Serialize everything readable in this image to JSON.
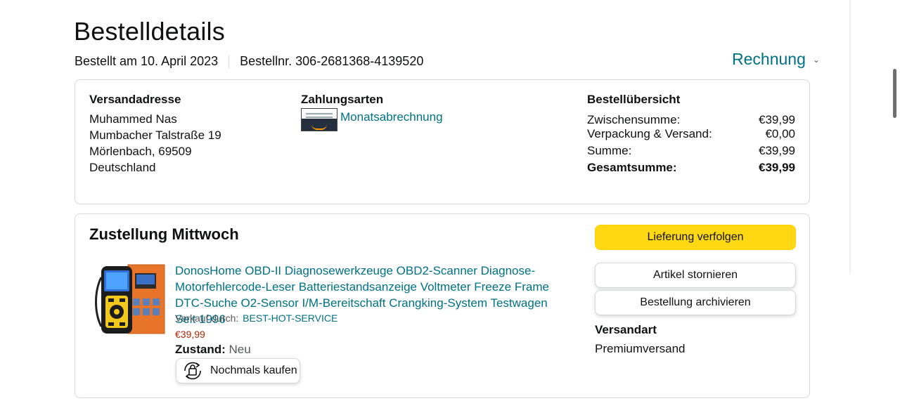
{
  "page": {
    "title": "Bestelldetails"
  },
  "order_meta": {
    "ordered_on": "Bestellt am 10. April 2023",
    "order_number": "Bestellnr. 306-2681368-4139520",
    "invoice_label": "Rechnung"
  },
  "address": {
    "heading": "Versandadresse",
    "name": "Muhammed Nas",
    "street": "Mumbacher Talstraße 19",
    "city": "Mörlenbach, 69509",
    "country": "Deutschland"
  },
  "payment": {
    "heading": "Zahlungsarten",
    "method": "Monatsabrechnung"
  },
  "summary": {
    "heading": "Bestellübersicht",
    "rows": [
      {
        "label": "Zwischensumme:",
        "value": "€39,99"
      },
      {
        "label": "Verpackung & Versand:",
        "value": "€0,00"
      },
      {
        "label": "Summe:",
        "value": "€39,99"
      },
      {
        "label": "Gesamtsumme:",
        "value": "€39,99"
      }
    ]
  },
  "delivery": {
    "title": "Zustellung Mittwoch",
    "product_title": "DonosHome OBD-II Diagnosewerkzeuge OBD2-Scanner Diagnose-Motorfehlercode-Leser Batteriestandsanzeige Voltmeter Freeze Frame DTC-Suche O2-Sensor I/M-Bereitschaft Crangking-System Testwagen Seit 1996",
    "sold_by_label": "Verkauf durch:",
    "seller": "BEST-HOT-SERVICE",
    "price": "€39,99",
    "condition_label": "Zustand:",
    "condition_value": "Neu",
    "rebuy_label": "Nochmals kaufen",
    "buttons": {
      "track": "Lieferung verfolgen",
      "cancel": "Artikel stornieren",
      "archive": "Bestellung archivieren"
    },
    "shipping_heading": "Versandart",
    "shipping_value": "Premiumversand"
  },
  "colors": {
    "link": "#007185",
    "primary_button": "#ffd814",
    "price": "#b12704",
    "border": "#d5d9d9"
  }
}
